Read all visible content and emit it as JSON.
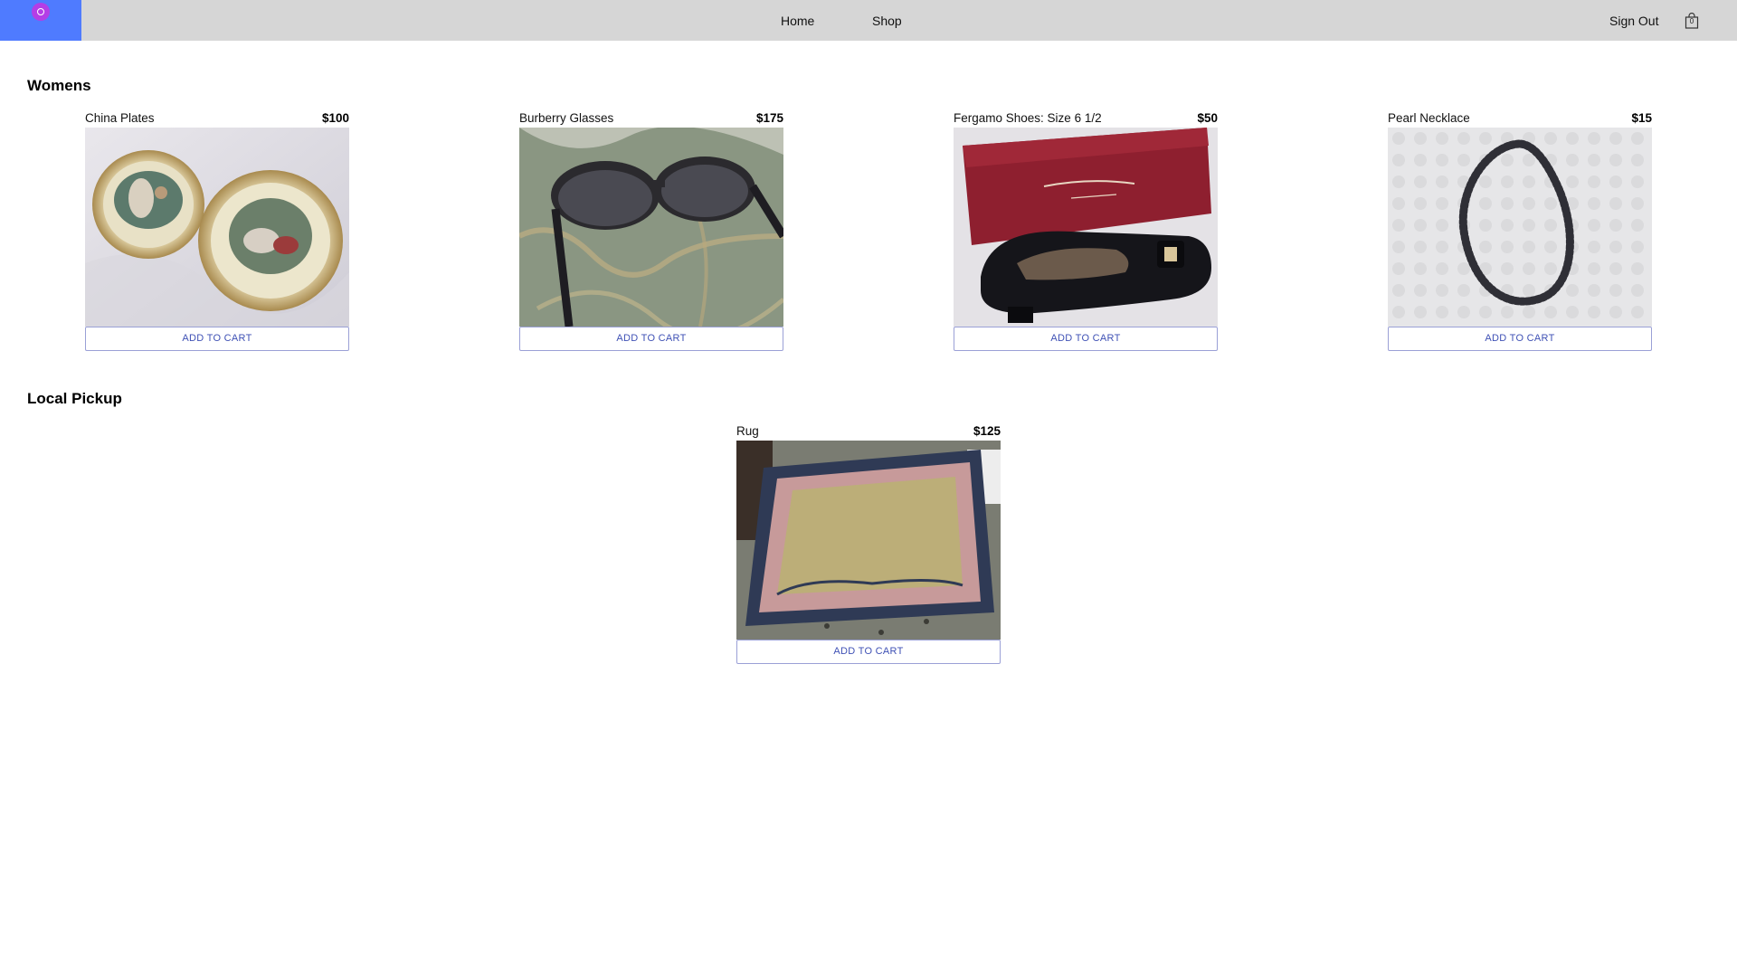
{
  "nav": {
    "links": [
      {
        "label": "Home"
      },
      {
        "label": "Shop"
      }
    ],
    "signout_label": "Sign Out",
    "cart_count": "0",
    "brand_color": "#4f7bff",
    "bar_color": "#d6d6d6"
  },
  "sections": [
    {
      "title": "Womens",
      "products": [
        {
          "name": "China Plates",
          "price": "$100",
          "button": "ADD TO CART",
          "image": "china-plates-photo"
        },
        {
          "name": "Burberry Glasses",
          "price": "$175",
          "button": "ADD TO CART",
          "image": "sunglasses-photo"
        },
        {
          "name": "Fergamo Shoes: Size 6 1/2",
          "price": "$50",
          "button": "ADD TO CART",
          "image": "shoes-photo"
        },
        {
          "name": "Pearl Necklace",
          "price": "$15",
          "button": "ADD TO CART",
          "image": "necklace-photo"
        }
      ]
    },
    {
      "title": "Local Pickup",
      "products": [
        {
          "name": "Rug",
          "price": "$125",
          "button": "ADD TO CART",
          "image": "rug-photo"
        }
      ]
    }
  ],
  "colors": {
    "button_text": "#3f51b5",
    "button_border": "#9aa0d6"
  }
}
